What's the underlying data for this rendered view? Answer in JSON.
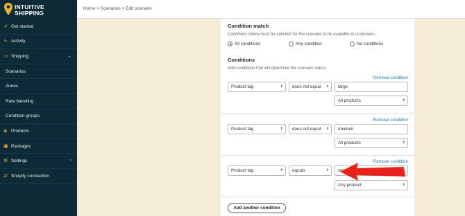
{
  "brand": {
    "line1": "INTUITIVE",
    "line2": "SHIPPING"
  },
  "sidebar": {
    "items": [
      {
        "label": "Get started",
        "icon": "rocket-icon"
      },
      {
        "label": "Activity",
        "icon": "activity-icon"
      },
      {
        "label": "Shipping",
        "icon": "truck-icon",
        "expanded": true
      },
      {
        "label": "Scenarios"
      },
      {
        "label": "Zones"
      },
      {
        "label": "Rate blending"
      },
      {
        "label": "Condition groups"
      },
      {
        "label": "Products",
        "icon": "tag-icon"
      },
      {
        "label": "Packages",
        "icon": "package-icon"
      },
      {
        "label": "Settings",
        "icon": "gear-icon"
      },
      {
        "label": "Shopify connection",
        "icon": "link-icon"
      }
    ]
  },
  "breadcrumb": "Home > Scenarios > Edit scenario",
  "condition_match": {
    "title": "Condition match",
    "description": "Conditions below must be satisfied for the scenario to be available to customers.",
    "options": [
      "All conditions",
      "Any condition",
      "No conditions"
    ],
    "selected": "All conditions"
  },
  "conditions": {
    "title": "Conditions",
    "description": "Add conditions that will determine the scenario status.",
    "remove_label": "Remove condition",
    "rows": [
      {
        "field": "Product tag",
        "operator": "does not equal",
        "value": "large",
        "scope": "All products"
      },
      {
        "field": "Product tag",
        "operator": "does not equal",
        "value": "medium",
        "scope": "All products"
      },
      {
        "field": "Product tag",
        "operator": "equals",
        "value": "small",
        "scope": "Any product"
      }
    ],
    "add_label": "Add another condition"
  },
  "colors": {
    "sidebar": "#0d2b36",
    "accent": "#f0b429",
    "link": "#1a7ca6",
    "arrow": "#e8231c",
    "background": "#f5ecd7"
  }
}
